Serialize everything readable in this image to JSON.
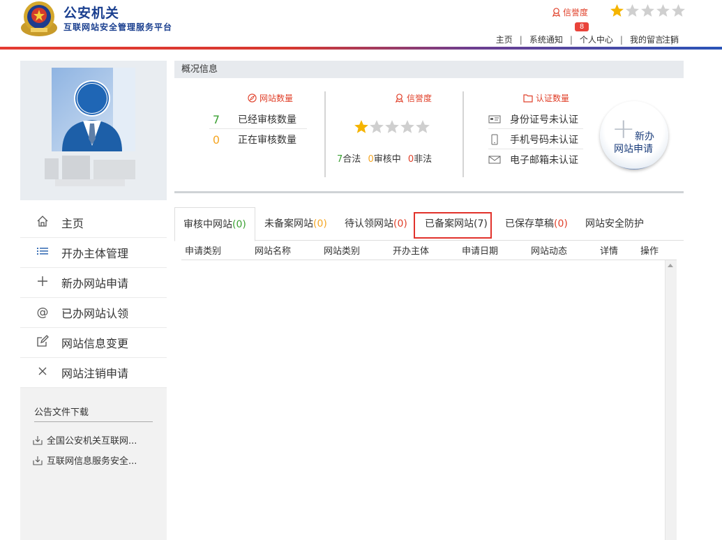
{
  "header": {
    "title": "公安机关",
    "subtitle": "互联网站安全管理服务平台",
    "credit_label": "信誉度",
    "credit_stars": 1,
    "credit_stars_max": 5,
    "message_badge": "8",
    "nav": [
      "主页",
      "系统通知",
      "个人中心",
      "我的留言",
      "注销"
    ]
  },
  "sidebar": {
    "menu": [
      {
        "label": "主页",
        "icon": "home-icon"
      },
      {
        "label": "开办主体管理",
        "icon": "list-icon"
      },
      {
        "label": "新办网站申请",
        "icon": "plus-icon"
      },
      {
        "label": "已办网站认领",
        "icon": "at-icon"
      },
      {
        "label": "网站信息变更",
        "icon": "edit-icon"
      },
      {
        "label": "网站注销申请",
        "icon": "close-icon"
      }
    ],
    "notice_title": "公告文件下载",
    "notices": [
      "全国公安机关互联网...",
      "互联网信息服务安全..."
    ]
  },
  "overview": {
    "title": "概况信息",
    "site_count": {
      "title": "网站数量",
      "reviewed_num": "7",
      "reviewed_label": "已经审核数量",
      "reviewing_num": "0",
      "reviewing_label": "正在审核数量"
    },
    "credit": {
      "title": "信誉度",
      "stars": 1,
      "legal_num": "7",
      "legal_label": "合法",
      "pending_num": "0",
      "pending_label": "审核中",
      "illegal_num": "0",
      "illegal_label": "非法"
    },
    "auth": {
      "title": "认证数量",
      "items": [
        "身份证号未认证",
        "手机号码未认证",
        "电子邮箱未认证"
      ]
    },
    "new_site_button": {
      "line1": "新办",
      "line2": "网站申请"
    }
  },
  "tabs": [
    {
      "label": "审核中网站",
      "count": "(0)",
      "color": "g"
    },
    {
      "label": "未备案网站",
      "count": "(0)",
      "color": "o"
    },
    {
      "label": "待认领网站",
      "count": "(0)",
      "color": "r"
    },
    {
      "label": "已备案网站",
      "count": "(7)",
      "color": "n"
    },
    {
      "label": "已保存草稿",
      "count": "(0)",
      "color": "r"
    },
    {
      "label": "网站安全防护",
      "count": "",
      "color": "n"
    }
  ],
  "table": {
    "columns": [
      "申请类别",
      "网站名称",
      "网站类别",
      "开办主体",
      "申请日期",
      "网站动态",
      "详情",
      "操作"
    ],
    "rows": []
  },
  "colors": {
    "brand": "#1a3f8f",
    "accent_red": "#e0402a",
    "green": "#3aa032",
    "orange": "#f5a623",
    "star": "#f5b400"
  }
}
